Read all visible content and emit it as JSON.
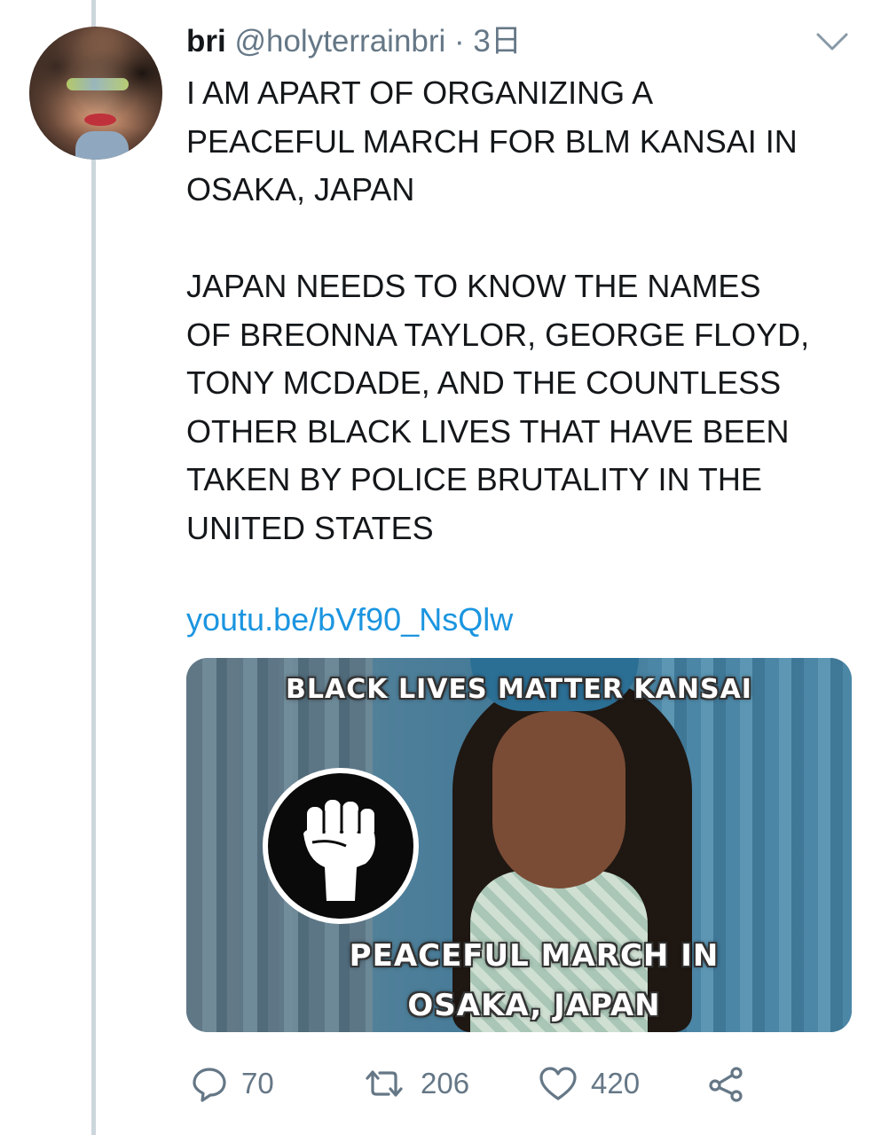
{
  "tweet": {
    "display_name": "bri",
    "handle": "@holyterrainbri",
    "separator": " · ",
    "time": "3日",
    "text": "I AM APART OF ORGANIZING A\nPEACEFUL MARCH FOR BLM KANSAI IN\nOSAKA, JAPAN\n\nJAPAN NEEDS TO KNOW THE NAMES\nOF BREONNA TAYLOR, GEORGE FLOYD,\nTONY MCDADE, AND THE COUNTLESS\nOTHER BLACK LIVES THAT HAVE BEEN\nTAKEN BY POLICE BRUTALITY IN THE\nUNITED STATES",
    "link": "youtu.be/bVf90_NsQlw"
  },
  "media": {
    "overlay_top": "BLACK LIVES MATTER KANSAI",
    "overlay_bottom": "PEACEFUL MARCH IN\nOSAKA, JAPAN"
  },
  "actions": {
    "replies": "70",
    "retweets": "206",
    "likes": "420"
  },
  "icons": [
    "chevron-down-icon",
    "reply-icon",
    "retweet-icon",
    "like-icon",
    "share-icon",
    "raised-fist-icon"
  ],
  "colors": {
    "link": "#1b95e0",
    "meta": "#657786",
    "thread_line": "#ccd6dd",
    "text": "#14171a"
  }
}
